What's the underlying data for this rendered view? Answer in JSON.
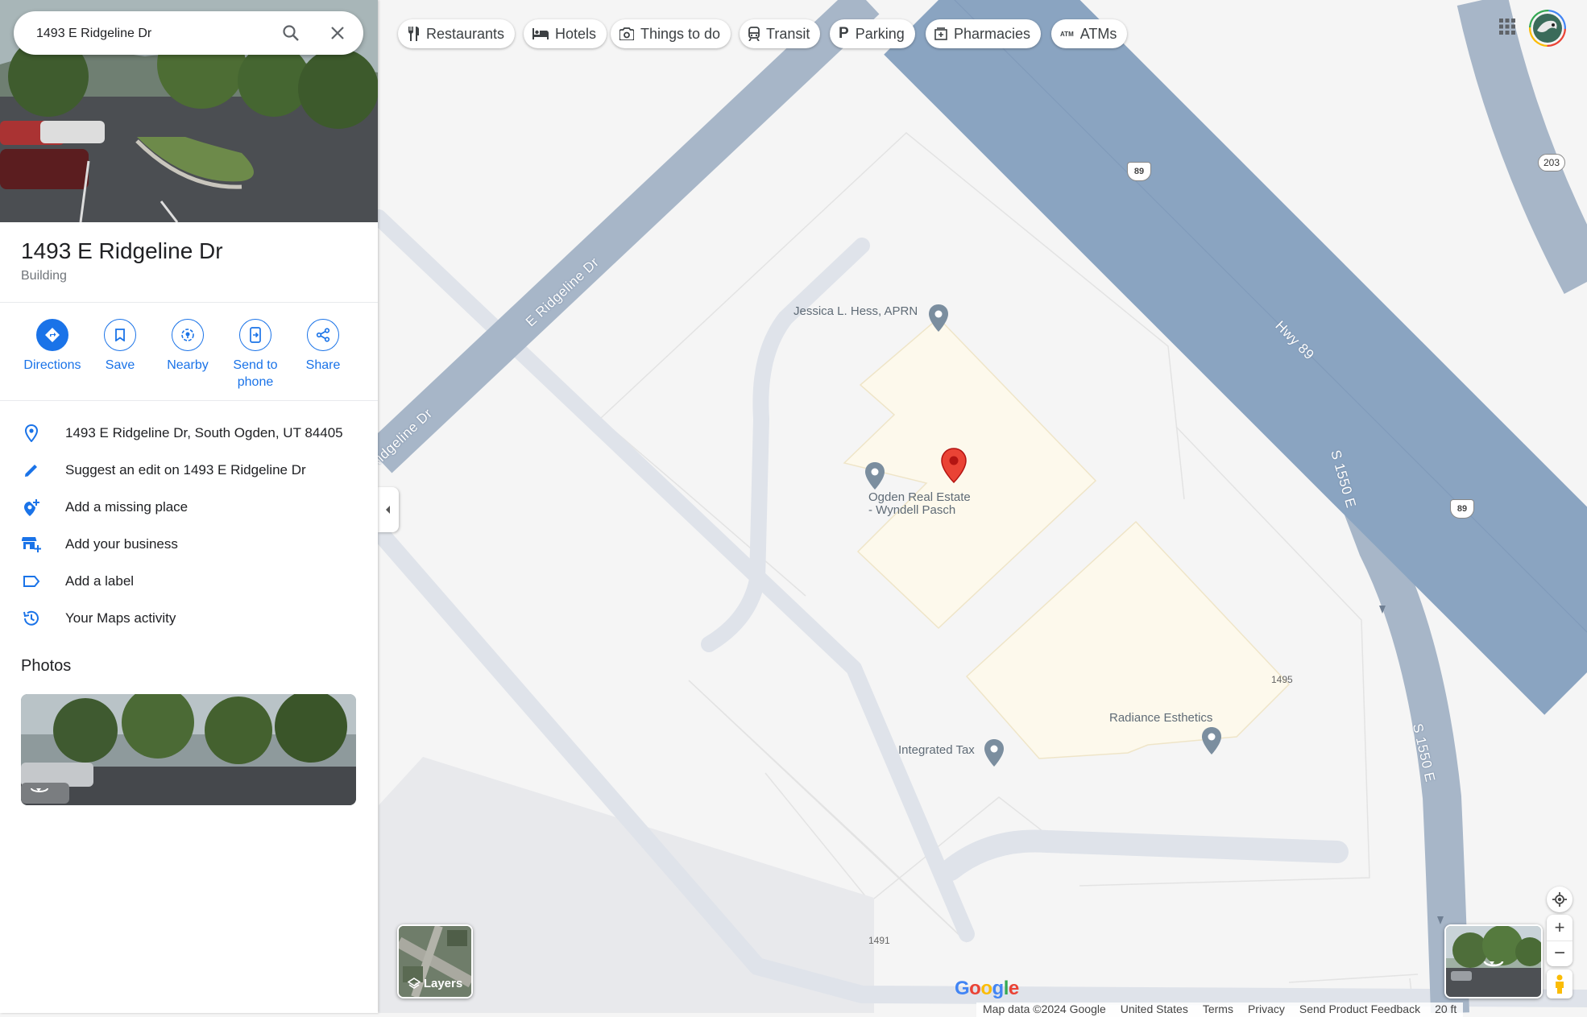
{
  "search": {
    "value": "1493 E Ridgeline Dr"
  },
  "place": {
    "title": "1493 E Ridgeline Dr",
    "type": "Building"
  },
  "actions": [
    {
      "label": "Directions",
      "icon": "directions-icon"
    },
    {
      "label": "Save",
      "icon": "bookmark-icon"
    },
    {
      "label": "Nearby",
      "icon": "nearby-icon"
    },
    {
      "label": "Send to phone",
      "icon": "send-to-phone-icon"
    },
    {
      "label": "Share",
      "icon": "share-icon"
    }
  ],
  "info_rows": [
    {
      "text": "1493 E Ridgeline Dr, South Ogden, UT 84405",
      "icon": "location-pin-icon"
    },
    {
      "text": "Suggest an edit on 1493 E Ridgeline Dr",
      "icon": "pencil-icon"
    },
    {
      "text": "Add a missing place",
      "icon": "add-place-icon"
    },
    {
      "text": "Add your business",
      "icon": "add-business-icon"
    },
    {
      "text": "Add a label",
      "icon": "label-icon"
    },
    {
      "text": "Your Maps activity",
      "icon": "history-icon"
    }
  ],
  "photos_heading": "Photos",
  "chips": [
    {
      "label": "Restaurants",
      "icon": "fork-knife-icon"
    },
    {
      "label": "Hotels",
      "icon": "bed-icon"
    },
    {
      "label": "Things to do",
      "icon": "camera-icon"
    },
    {
      "label": "Transit",
      "icon": "train-icon"
    },
    {
      "label": "Parking",
      "icon": "parking-icon"
    },
    {
      "label": "Pharmacies",
      "icon": "pharmacy-icon"
    },
    {
      "label": "ATMs",
      "icon": "atm-icon"
    }
  ],
  "map": {
    "road_labels": [
      "E Ridgeline Dr",
      "Ridgeline Dr",
      "Hwy 89",
      "S 1550 E",
      "S 1550 E"
    ],
    "shields": [
      "89",
      "89",
      "203"
    ],
    "places": [
      "Jessica L. Hess, APRN",
      "Ogden Real Estate\n- Wyndell Pasch",
      "Radiance Esthetics",
      "Integrated Tax"
    ],
    "address_numbers": [
      "1495",
      "1491"
    ]
  },
  "layers_label": "Layers",
  "footer": {
    "logo": "Google",
    "items": [
      "Map data ©2024 Google",
      "United States",
      "Terms",
      "Privacy",
      "Send Product Feedback",
      "20 ft"
    ]
  },
  "colors": {
    "accent": "#1a73e8",
    "highway": "#8aa4c1",
    "road": "#dfe3ea",
    "building": "#fdf9ec",
    "pin": "#ea4335"
  }
}
